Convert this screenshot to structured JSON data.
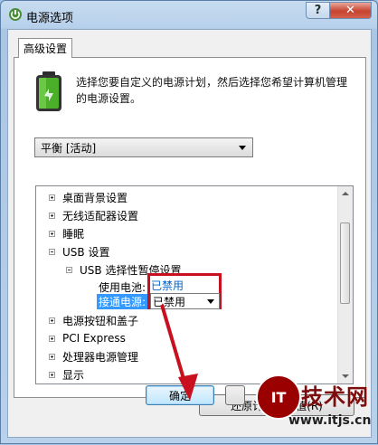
{
  "window": {
    "title": "电源选项"
  },
  "caption_buttons": {
    "help": "?",
    "close": "✕"
  },
  "tab": {
    "label": "高级设置"
  },
  "description": "选择您要自定义的电源计划，然后选择您希望计算机管理的电源设置。",
  "plan_select": {
    "value": "平衡 [活动]"
  },
  "tree": [
    {
      "label": "桌面背景设置",
      "expander": "plus"
    },
    {
      "label": "无线适配器设置",
      "expander": "plus"
    },
    {
      "label": "睡眠",
      "expander": "plus"
    },
    {
      "label": "USB 设置",
      "expander": "minus"
    },
    {
      "label": "USB 选择性暂停设置",
      "expander": "minus"
    },
    {
      "label": "使用电池:",
      "expander": "none"
    },
    {
      "label": "接通电源:",
      "expander": "none"
    },
    {
      "label": "电源按钮和盖子",
      "expander": "plus"
    },
    {
      "label": "PCI Express",
      "expander": "plus"
    },
    {
      "label": "处理器电源管理",
      "expander": "plus"
    },
    {
      "label": "显示",
      "expander": "plus"
    }
  ],
  "battery_value": "已禁用",
  "plugged_value": "已禁用",
  "buttons": {
    "restore": "还原计划默认值(R)",
    "ok": "确定"
  },
  "watermark": {
    "logo": "IT",
    "text": "技术网",
    "url": "www.itjs.cn"
  },
  "colors": {
    "highlight_box": "#c8101e",
    "selection": "#3399ff",
    "link": "#0066cc"
  },
  "icons": {
    "title": "power-options-icon",
    "panel": "battery-icon"
  }
}
